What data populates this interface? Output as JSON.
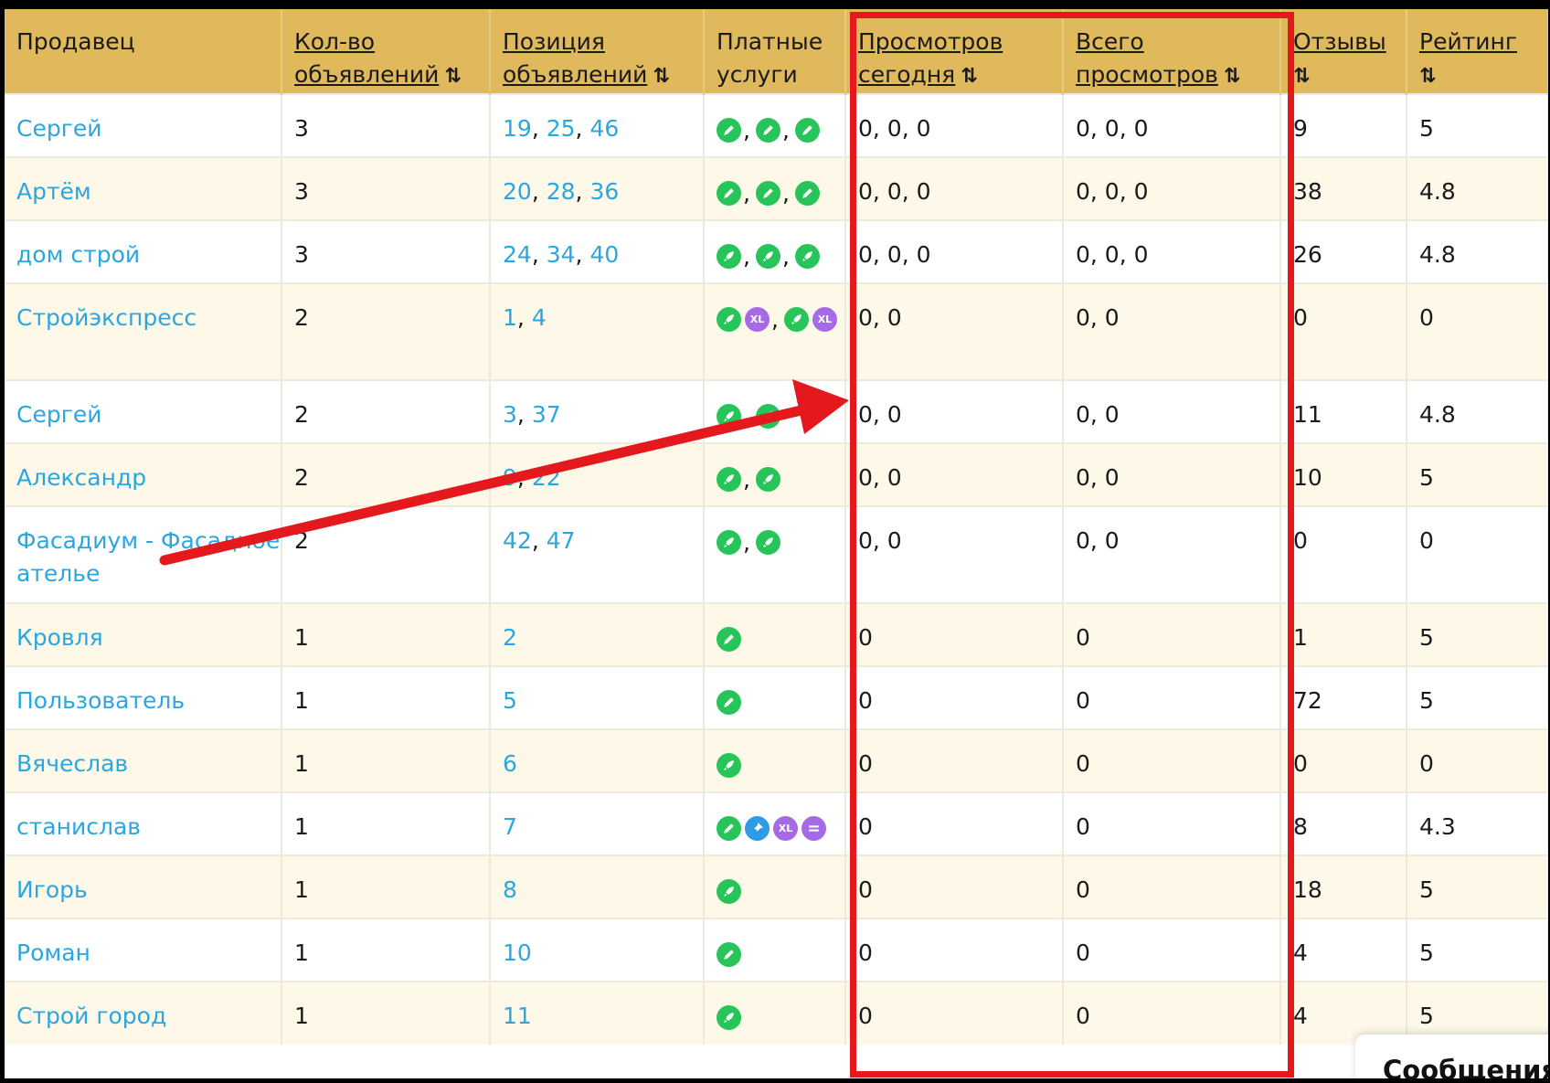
{
  "header": {
    "seller": "Продавец",
    "count_line1": "Кол-во",
    "count_line2": "объявлений",
    "position_line1": "Позиция",
    "position_line2": "объявлений",
    "paid_line1": "Платные",
    "paid_line2": "услуги",
    "views_today_line1": "Просмотров",
    "views_today_line2": "сегодня",
    "views_total_line1": "Всего",
    "views_total_line2": "просмотров",
    "reviews": "Отзывы",
    "rating": "Рейтинг",
    "sort_icon": "⇅"
  },
  "rows": [
    {
      "seller": "Сергей",
      "count": "3",
      "positions": [
        "19",
        "25",
        "46"
      ],
      "services": [
        [
          "green-pencil"
        ],
        [
          "green-pencil"
        ],
        [
          "green-pencil"
        ]
      ],
      "views_today": "0, 0, 0",
      "views_total": "0, 0, 0",
      "reviews": "9",
      "rating": "5"
    },
    {
      "seller": "Артём",
      "count": "3",
      "positions": [
        "20",
        "28",
        "36"
      ],
      "services": [
        [
          "green-pencil"
        ],
        [
          "green-pencil"
        ],
        [
          "green-pencil"
        ]
      ],
      "views_today": "0, 0, 0",
      "views_total": "0, 0, 0",
      "reviews": "38",
      "rating": "4.8"
    },
    {
      "seller": "дом строй",
      "count": "3",
      "positions": [
        "24",
        "34",
        "40"
      ],
      "services": [
        [
          "green-rocket"
        ],
        [
          "green-rocket"
        ],
        [
          "green-rocket"
        ]
      ],
      "views_today": "0, 0, 0",
      "views_total": "0, 0, 0",
      "reviews": "26",
      "rating": "4.8"
    },
    {
      "seller": "Стройэкспресс",
      "count": "2",
      "positions": [
        "1",
        "4"
      ],
      "services": [
        [
          "green-rocket",
          "purple-xl"
        ],
        [
          "green-rocket",
          "purple-xl"
        ]
      ],
      "views_today": "0, 0",
      "views_total": "0, 0",
      "reviews": "0",
      "rating": "0",
      "tall": true
    },
    {
      "seller": "Сергей",
      "count": "2",
      "positions": [
        "3",
        "37"
      ],
      "services": [
        [
          "green-rocket"
        ],
        [
          "green-rocket"
        ]
      ],
      "views_today": "0, 0",
      "views_total": "0, 0",
      "reviews": "11",
      "rating": "4.8"
    },
    {
      "seller": "Александр",
      "count": "2",
      "positions": [
        "9",
        "22"
      ],
      "services": [
        [
          "green-rocket"
        ],
        [
          "green-rocket"
        ]
      ],
      "views_today": "0, 0",
      "views_total": "0, 0",
      "reviews": "10",
      "rating": "5"
    },
    {
      "seller": "Фасадиум - Фасадное ателье",
      "count": "2",
      "positions": [
        "42",
        "47"
      ],
      "services": [
        [
          "green-rocket"
        ],
        [
          "green-rocket"
        ]
      ],
      "views_today": "0, 0",
      "views_total": "0, 0",
      "reviews": "0",
      "rating": "0",
      "tall": true
    },
    {
      "seller": "Кровля",
      "count": "1",
      "positions": [
        "2"
      ],
      "services": [
        [
          "green-pencil"
        ]
      ],
      "views_today": "0",
      "views_total": "0",
      "reviews": "1",
      "rating": "5"
    },
    {
      "seller": "Пользователь",
      "count": "1",
      "positions": [
        "5"
      ],
      "services": [
        [
          "green-pencil"
        ]
      ],
      "views_today": "0",
      "views_total": "0",
      "reviews": "72",
      "rating": "5"
    },
    {
      "seller": "Вячеслав",
      "count": "1",
      "positions": [
        "6"
      ],
      "services": [
        [
          "green-rocket"
        ]
      ],
      "views_today": "0",
      "views_total": "0",
      "reviews": "0",
      "rating": "0"
    },
    {
      "seller": "станислав",
      "count": "1",
      "positions": [
        "7"
      ],
      "services": [
        [
          "green-pencil",
          "blue-pin",
          "purple-xl",
          "purple-lines"
        ]
      ],
      "views_today": "0",
      "views_total": "0",
      "reviews": "8",
      "rating": "4.3"
    },
    {
      "seller": "Игорь",
      "count": "1",
      "positions": [
        "8"
      ],
      "services": [
        [
          "green-rocket"
        ]
      ],
      "views_today": "0",
      "views_total": "0",
      "reviews": "18",
      "rating": "5"
    },
    {
      "seller": "Роман",
      "count": "1",
      "positions": [
        "10"
      ],
      "services": [
        [
          "green-pencil"
        ]
      ],
      "views_today": "0",
      "views_total": "0",
      "reviews": "4",
      "rating": "5"
    },
    {
      "seller": "Строй город",
      "count": "1",
      "positions": [
        "11"
      ],
      "services": [
        [
          "green-rocket"
        ]
      ],
      "views_today": "0",
      "views_total": "0",
      "reviews": "4",
      "rating": "5"
    }
  ],
  "icon_labels": {
    "xl": "XL"
  },
  "messages_label": "Сообщения",
  "colors": {
    "header_bg": "#dfb95c",
    "link": "#2aa7e0",
    "highlight": "#e3191e",
    "stripe": "#fdf8e8",
    "service_green": "#27c45a",
    "service_blue": "#2e9be8",
    "service_purple": "#a66ae6"
  }
}
